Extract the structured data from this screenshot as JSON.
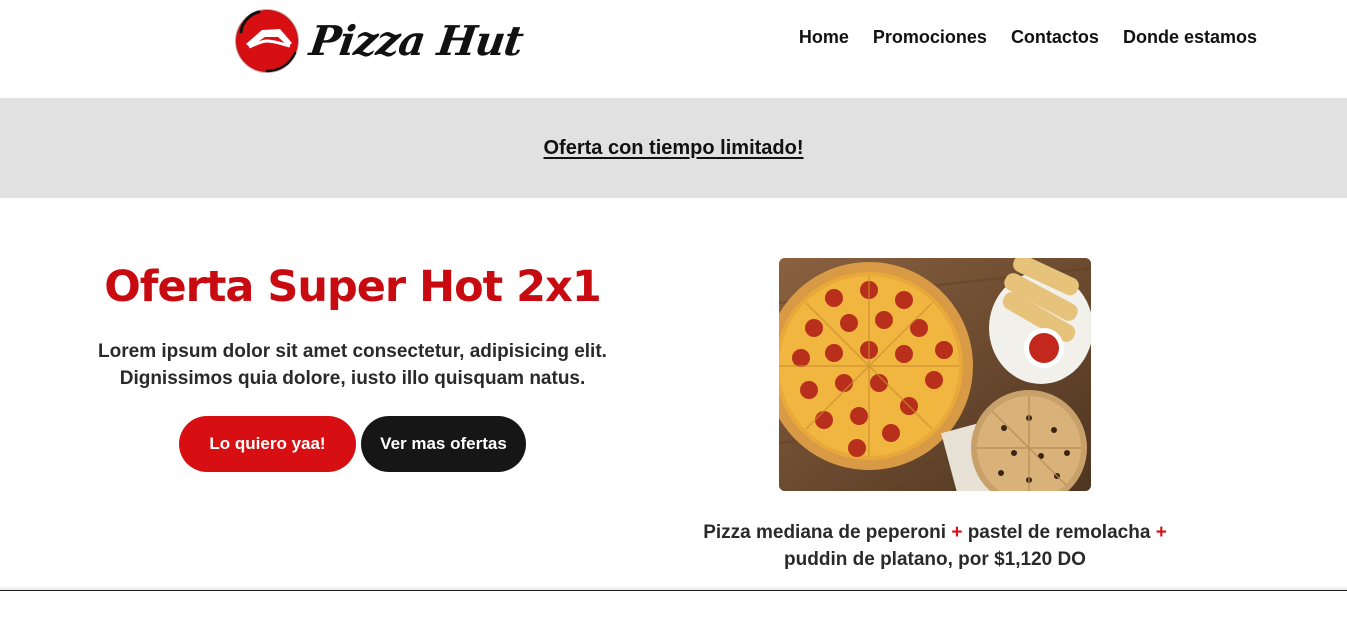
{
  "brand": {
    "name": "Pizza Hut",
    "logo_icon": "pizza-hut-roof-icon",
    "accent_color": "#c80b10"
  },
  "nav": {
    "items": [
      {
        "label": "Home"
      },
      {
        "label": "Promociones"
      },
      {
        "label": "Contactos"
      },
      {
        "label": "Donde estamos"
      }
    ]
  },
  "promo_band": {
    "link_text": "Oferta con tiempo limitado!",
    "background_color": "#e1e1e1"
  },
  "offer": {
    "title": "Oferta Super Hot 2x1",
    "description_line1": "Lorem ipsum dolor sit amet consectetur, adipisicing elit.",
    "description_line2": "Dignissimos quia dolore, iusto illo quisquam natus.",
    "primary_button": "Lo quiero yaa!",
    "secondary_button": "Ver mas ofertas",
    "primary_color": "#d80f12",
    "secondary_color": "#161616"
  },
  "product": {
    "image_subject": "pepperoni pizza, breadsticks with sauce and cookie pie",
    "caption": {
      "part1": "Pizza mediana de peperoni",
      "plus1": "+",
      "part2": "pastel de remolacha",
      "plus2": "+",
      "part3": "puddin de platano, por $1,120 DO"
    }
  }
}
